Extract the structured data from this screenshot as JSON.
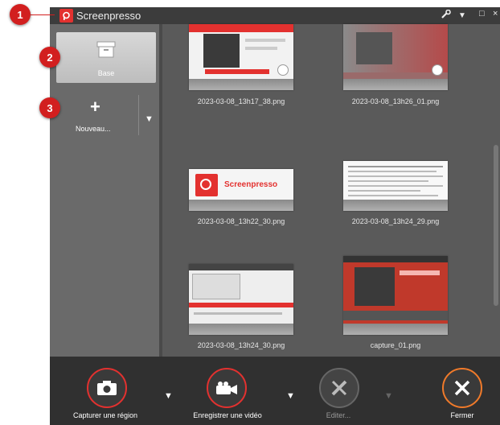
{
  "app": {
    "title": "Screenpresso"
  },
  "markers": [
    "1",
    "2",
    "3"
  ],
  "sidebar": {
    "base_label": "Base",
    "new_label": "Nouveau..."
  },
  "thumbnails": [
    {
      "filename": "2023-03-08_13h17_38.png"
    },
    {
      "filename": "2023-03-08_13h26_01.png"
    },
    {
      "filename": "2023-03-08_13h22_30.png",
      "brand": "Screenpresso"
    },
    {
      "filename": "2023-03-08_13h24_29.png"
    },
    {
      "filename": "2023-03-08_13h24_30.png"
    },
    {
      "filename": "capture_01.png"
    }
  ],
  "toolbar": {
    "capture_region": "Capturer une région",
    "record_video": "Enregistrer une vidéo",
    "edit": "Editer...",
    "close": "Fermer"
  },
  "colors": {
    "accent": "#e3312f",
    "marker": "#d21f1f",
    "close_ring": "#f07a2a"
  }
}
